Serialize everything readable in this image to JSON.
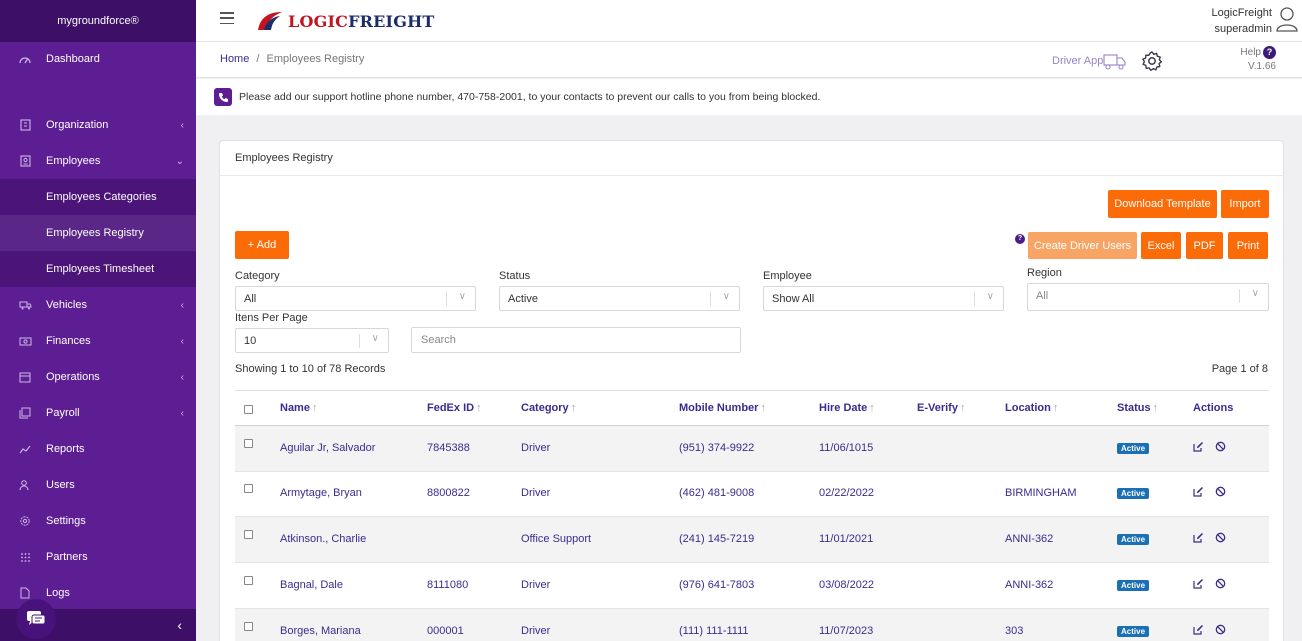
{
  "sidebar": {
    "brand": "mygroundforce®",
    "items": [
      {
        "label": "Dashboard",
        "icon": "gauge-icon"
      },
      {
        "label": "Organization",
        "icon": "building-icon"
      },
      {
        "label": "Employees",
        "icon": "badge-icon"
      },
      {
        "label": "Vehicles",
        "icon": "truck-icon"
      },
      {
        "label": "Finances",
        "icon": "money-icon"
      },
      {
        "label": "Operations",
        "icon": "calendar-icon"
      },
      {
        "label": "Payroll",
        "icon": "copy-icon"
      },
      {
        "label": "Reports",
        "icon": "chart-icon"
      },
      {
        "label": "Users",
        "icon": "users-icon"
      },
      {
        "label": "Settings",
        "icon": "gear-icon"
      },
      {
        "label": "Partners",
        "icon": "grid-icon"
      },
      {
        "label": "Logs",
        "icon": "file-icon"
      }
    ],
    "sub_items": [
      {
        "label": "Employees Categories"
      },
      {
        "label": "Employees Registry"
      },
      {
        "label": "Employees Timesheet"
      }
    ]
  },
  "header": {
    "logo_part1": "LOGIC",
    "logo_part2": "FREIGHT",
    "company": "LogicFreight",
    "username": "superadmin"
  },
  "breadcrumb": {
    "home": "Home",
    "separator": "/",
    "current": "Employees Registry"
  },
  "toolbar": {
    "driver_app": "Driver App",
    "help": "Help",
    "version": "V.1.66"
  },
  "notice": {
    "text": "Please add our support hotline phone number, 470-758-2001, to your contacts to prevent our calls to you from being blocked."
  },
  "card": {
    "title": "Employees Registry",
    "buttons": {
      "download_template": "Download Template",
      "import": "Import",
      "add": "+ Add",
      "create_driver_users": "Create Driver Users",
      "excel": "Excel",
      "pdf": "PDF",
      "print": "Print"
    },
    "filters": {
      "category_label": "Category",
      "category_value": "All",
      "status_label": "Status",
      "status_value": "Active",
      "employee_label": "Employee",
      "employee_value": "Show All",
      "region_label": "Region",
      "region_placeholder": "All",
      "per_page_label": "Itens Per Page",
      "per_page_value": "10",
      "search_placeholder": "Search"
    },
    "showing": "Showing 1 to 10 of 78 Records",
    "page": "Page 1 of 8"
  },
  "table": {
    "headers": [
      "Name",
      "FedEx ID",
      "Category",
      "Mobile Number",
      "Hire Date",
      "E-Verify",
      "Location",
      "Status",
      "Actions"
    ],
    "rows": [
      {
        "name": "Aguilar Jr, Salvador",
        "fedex": "7845388",
        "category": "Driver",
        "mobile": "(951) 374-9922",
        "hire": "11/06/1015",
        "everify": "",
        "location": "",
        "status": "Active"
      },
      {
        "name": "Armytage, Bryan",
        "fedex": "8800822",
        "category": "Driver",
        "mobile": "(462) 481-9008",
        "hire": "02/22/2022",
        "everify": "",
        "location": "BIRMINGHAM",
        "status": "Active"
      },
      {
        "name": "Atkinson., Charlie",
        "fedex": "",
        "category": "Office Support",
        "mobile": "(241) 145-7219",
        "hire": "11/01/2021",
        "everify": "",
        "location": "ANNI-362",
        "status": "Active"
      },
      {
        "name": "Bagnal, Dale",
        "fedex": "8111080",
        "category": "Driver",
        "mobile": "(976) 641-7803",
        "hire": "03/08/2022",
        "everify": "",
        "location": "ANNI-362",
        "status": "Active"
      },
      {
        "name": "Borges, Mariana",
        "fedex": "000001",
        "category": "Driver",
        "mobile": "(111) 111-1111",
        "hire": "11/07/2023",
        "everify": "",
        "location": "303",
        "status": "Active"
      }
    ]
  },
  "colors": {
    "sidebar": "#5e1e93",
    "sidebar_dark": "#3d0f66",
    "accent": "#fb6b07",
    "link": "#3d2a8f",
    "badge": "#1b6fb5"
  }
}
